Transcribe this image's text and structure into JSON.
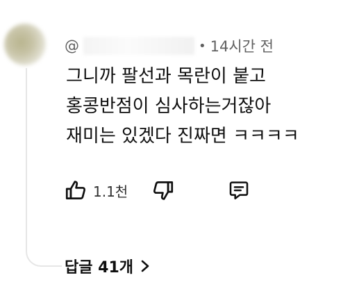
{
  "comment": {
    "handle_prefix": "@",
    "handle_tail": "",
    "separator": "•",
    "timestamp": "14시간 전",
    "lines": [
      "그니까 팔선과 목란이 붙고",
      "홍콩반점이 심사하는거잖아",
      "재미는 있겠다 진짜면 ㅋㅋㅋㅋ"
    ]
  },
  "actions": {
    "like_icon": "thumbs-up-icon",
    "like_count": "1.1천",
    "dislike_icon": "thumbs-down-icon",
    "reply_icon": "reply-comment-icon"
  },
  "replies": {
    "label": "답글 41개",
    "chevron_icon": "chevron-right-icon"
  },
  "colors": {
    "text_primary": "#0f0f0f",
    "text_secondary": "#606060",
    "thread_line": "#e6e6e6"
  }
}
